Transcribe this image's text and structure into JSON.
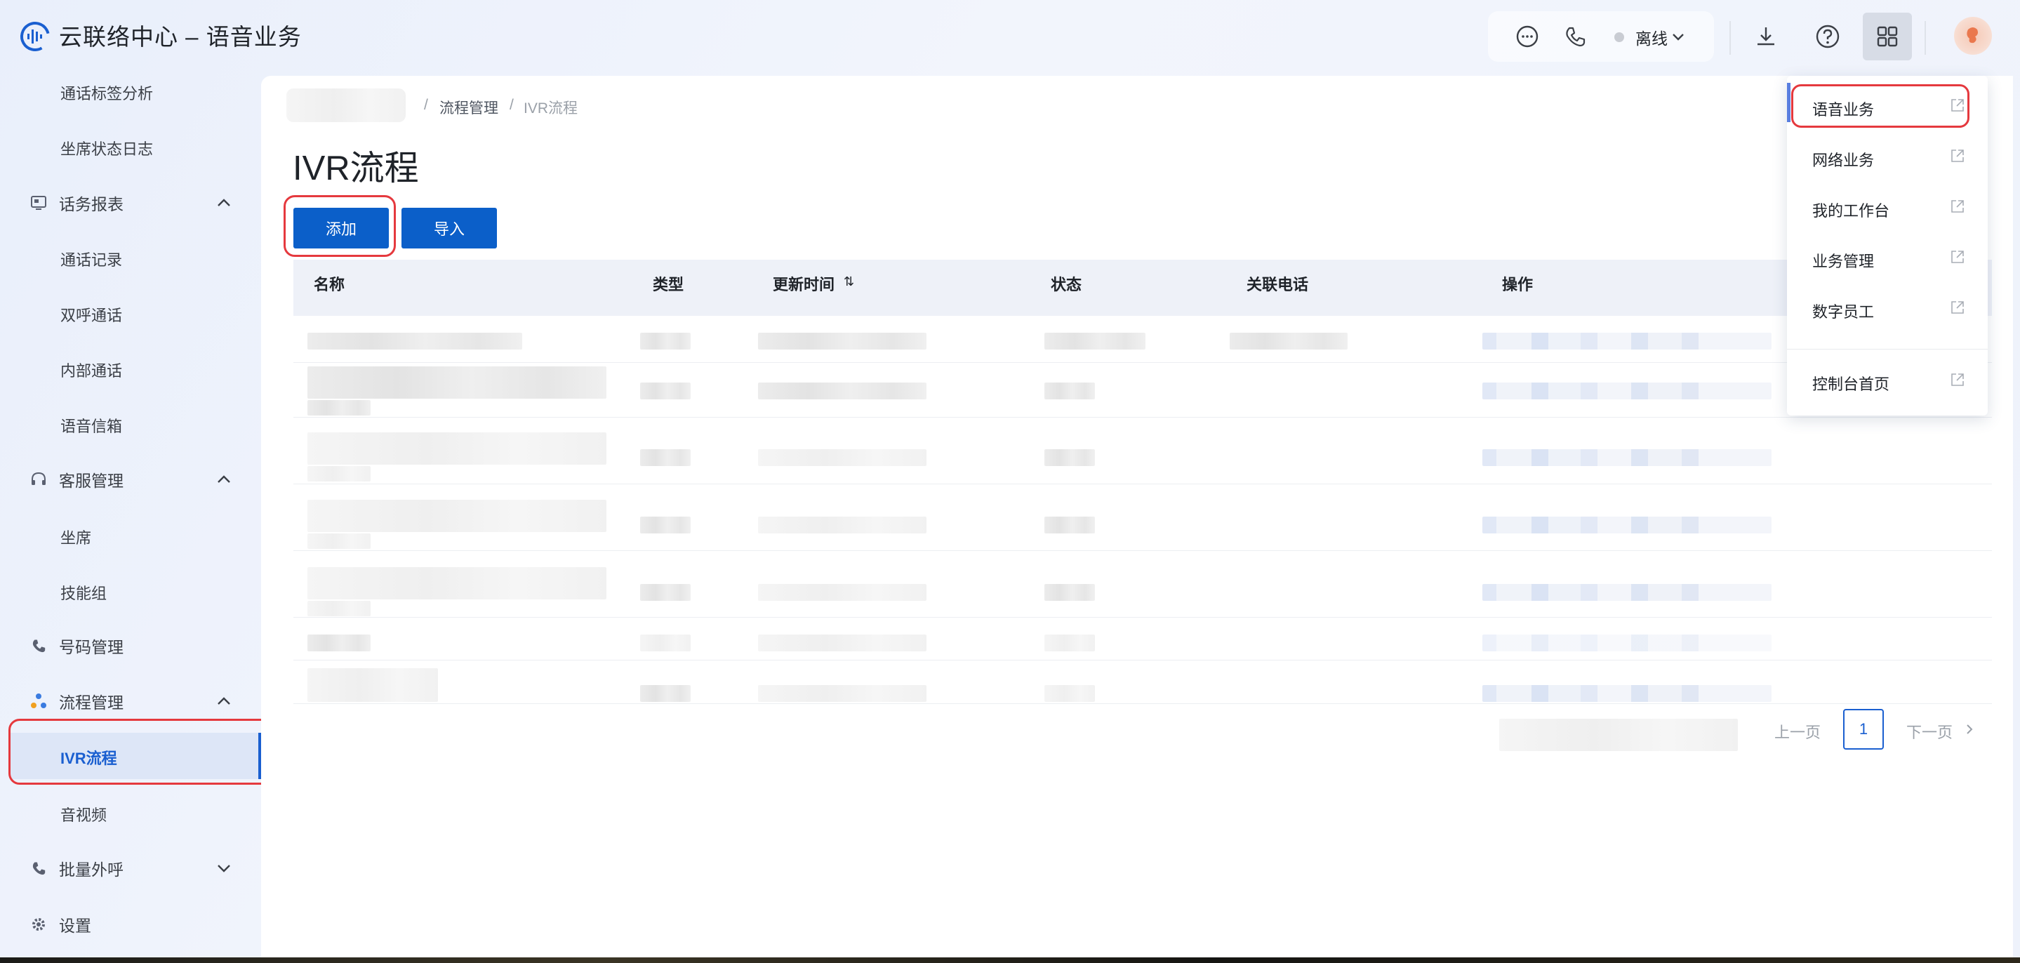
{
  "header": {
    "title": "云联络中心 – 语音业务",
    "status_label": "离线",
    "icons": [
      "voice-logo-icon",
      "chat-icon",
      "phone-icon",
      "chevron-down-icon",
      "download-icon",
      "help-icon",
      "apps-grid-icon",
      "avatar"
    ]
  },
  "sidebar": {
    "items": [
      {
        "label": "通话标签分析",
        "type": "sub"
      },
      {
        "label": "坐席状态日志",
        "type": "sub"
      },
      {
        "label": "话务报表",
        "type": "group",
        "expanded": true,
        "icon": "report-icon"
      },
      {
        "label": "通话记录",
        "type": "sub"
      },
      {
        "label": "双呼通话",
        "type": "sub"
      },
      {
        "label": "内部通话",
        "type": "sub"
      },
      {
        "label": "语音信箱",
        "type": "sub"
      },
      {
        "label": "客服管理",
        "type": "group",
        "expanded": true,
        "icon": "headset-icon"
      },
      {
        "label": "坐席",
        "type": "sub"
      },
      {
        "label": "技能组",
        "type": "sub"
      },
      {
        "label": "号码管理",
        "type": "group",
        "icon": "phone-icon"
      },
      {
        "label": "流程管理",
        "type": "group",
        "expanded": true,
        "icon": "flow-icon"
      },
      {
        "label": "IVR流程",
        "type": "sub",
        "active": true
      },
      {
        "label": "音视频",
        "type": "sub"
      },
      {
        "label": "批量外呼",
        "type": "group",
        "expanded": false,
        "icon": "phone-icon"
      },
      {
        "label": "设置",
        "type": "group",
        "icon": "gear-icon"
      }
    ]
  },
  "breadcrumb": {
    "items": [
      "流程管理",
      "IVR流程"
    ],
    "separator": "/"
  },
  "page": {
    "title": "IVR流程"
  },
  "toolbar": {
    "add_label": "添加",
    "import_label": "导入"
  },
  "table": {
    "columns": [
      "名称",
      "类型",
      "更新时间",
      "状态",
      "关联电话",
      "操作"
    ],
    "sort_icon": "⇅",
    "rows_note_hidden": 7
  },
  "pagination": {
    "prev": "上一页",
    "current": "1",
    "next": "下一页"
  },
  "dropdown": {
    "items": [
      {
        "label": "语音业务",
        "selected": true
      },
      {
        "label": "网络业务"
      },
      {
        "label": "我的工作台"
      },
      {
        "label": "业务管理"
      },
      {
        "label": "数字员工"
      },
      {
        "label": "控制台首页"
      }
    ]
  },
  "colors": {
    "primary": "#0b5fc9",
    "highlight": "#e5393e",
    "active_bg": "#dde6f7"
  }
}
